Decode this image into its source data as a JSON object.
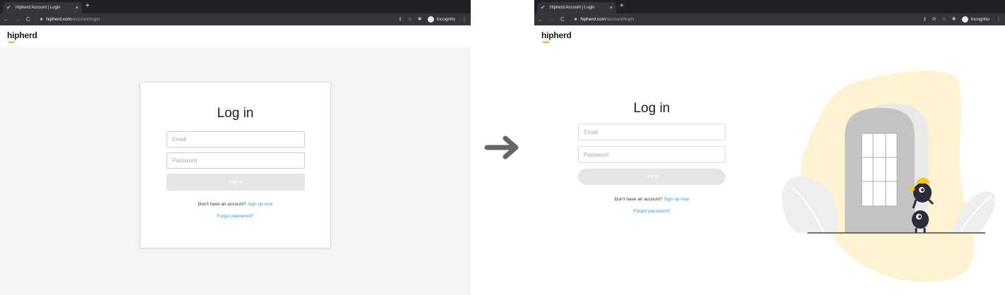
{
  "browser": {
    "tab_title": "Hipherd Account | Login",
    "tab_close": "×",
    "new_tab": "+",
    "url_host": "hipherd.com",
    "url_path": "/account/login",
    "incognito_label": "Incognito"
  },
  "brand": {
    "logo_text": "hipherd",
    "accent": "#f5a623"
  },
  "login": {
    "title": "Log in",
    "email_placeholder": "Email",
    "password_placeholder": "Password",
    "submit_label": "Log in",
    "signup_prompt": "Don't have an account?",
    "signup_link": "Sign up now",
    "forgot_link": "Forgot password?"
  },
  "colors": {
    "link": "#2b9be0",
    "blob": "#fdf3d1",
    "door": "#c8c8c8"
  },
  "icons": [
    "back-arrow-icon",
    "forward-arrow-icon",
    "reload-icon",
    "lock-icon",
    "key-icon",
    "eye-off-icon",
    "star-icon",
    "puzzle-icon",
    "incognito-icon",
    "kebab-menu-icon",
    "transition-arrow-icon"
  ]
}
